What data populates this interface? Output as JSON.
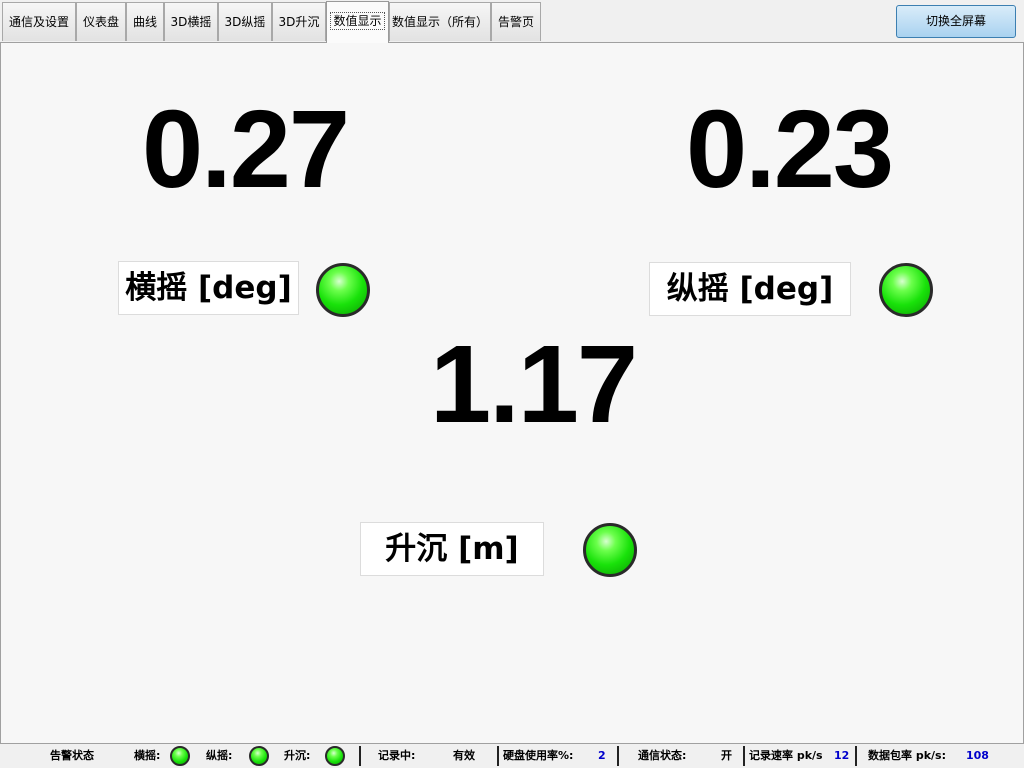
{
  "tabs": [
    {
      "label": "通信及设置"
    },
    {
      "label": "仪表盘"
    },
    {
      "label": "曲线"
    },
    {
      "label": "3D横摇"
    },
    {
      "label": "3D纵摇"
    },
    {
      "label": "3D升沉"
    },
    {
      "label": "数值显示"
    },
    {
      "label": "数值显示（所有）"
    },
    {
      "label": "告警页"
    }
  ],
  "active_tab": "数值显示",
  "fullscreen_button": "切换全屏幕",
  "readings": {
    "roll": {
      "value": "0.27",
      "label": "横摇 [deg]",
      "status": "ok"
    },
    "pitch": {
      "value": "0.23",
      "label": "纵摇 [deg]",
      "status": "ok"
    },
    "heave": {
      "value": "1.17",
      "label": "升沉 [m]",
      "status": "ok"
    }
  },
  "status_bar": {
    "alarm_title": "告警状态",
    "roll_label": "横摇:",
    "pitch_label": "纵摇:",
    "heave_label": "升沉:",
    "recording_label": "记录中:",
    "recording_value": "有效",
    "disk_label": "硬盘使用率%:",
    "disk_value": "2",
    "comm_label": "通信状态:",
    "comm_value": "开",
    "record_rate_label": "记录速率 pk/s",
    "record_rate_value": "12",
    "packet_rate_label": "数据包率 pk/s:",
    "packet_rate_value": "108"
  },
  "colors": {
    "led_ok": "#19e20a",
    "status_number": "#0000cc",
    "button_blue": "#a9d2f0"
  }
}
